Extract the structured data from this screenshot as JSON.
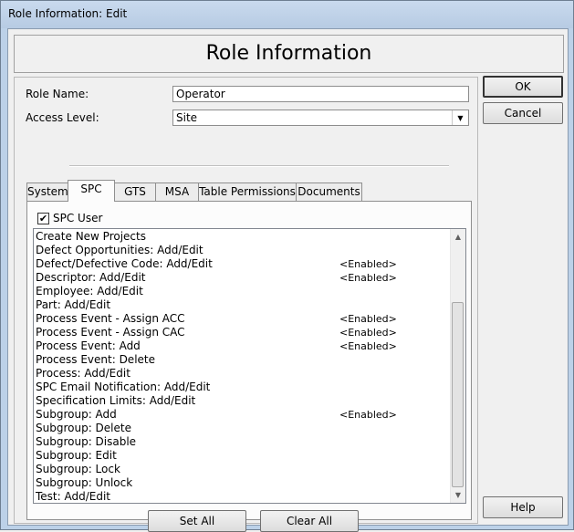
{
  "window": {
    "title": "Role Information: Edit"
  },
  "header": {
    "title": "Role Information"
  },
  "form": {
    "role_name_label": "Role Name:",
    "role_name_value": "Operator",
    "access_level_label": "Access Level:",
    "access_level_value": "Site"
  },
  "tabs": [
    {
      "label": "System"
    },
    {
      "label": "SPC"
    },
    {
      "label": "GTS"
    },
    {
      "label": "MSA"
    },
    {
      "label": "Table Permissions"
    },
    {
      "label": "Documents"
    }
  ],
  "active_tab": "SPC",
  "spc": {
    "user_checkbox_label": "SPC User",
    "user_checked": true,
    "permissions": [
      {
        "name": "Create New Projects",
        "status": ""
      },
      {
        "name": "Defect Opportunities: Add/Edit",
        "status": ""
      },
      {
        "name": "Defect/Defective Code: Add/Edit",
        "status": "<Enabled>"
      },
      {
        "name": "Descriptor: Add/Edit",
        "status": "<Enabled>"
      },
      {
        "name": "Employee: Add/Edit",
        "status": ""
      },
      {
        "name": "Part: Add/Edit",
        "status": ""
      },
      {
        "name": "Process Event - Assign ACC",
        "status": "<Enabled>"
      },
      {
        "name": "Process Event - Assign CAC",
        "status": "<Enabled>"
      },
      {
        "name": "Process Event: Add",
        "status": "<Enabled>"
      },
      {
        "name": "Process Event: Delete",
        "status": ""
      },
      {
        "name": "Process: Add/Edit",
        "status": ""
      },
      {
        "name": "SPC Email Notification: Add/Edit",
        "status": ""
      },
      {
        "name": "Specification Limits: Add/Edit",
        "status": ""
      },
      {
        "name": "Subgroup: Add",
        "status": "<Enabled>"
      },
      {
        "name": "Subgroup: Delete",
        "status": ""
      },
      {
        "name": "Subgroup: Disable",
        "status": ""
      },
      {
        "name": "Subgroup: Edit",
        "status": ""
      },
      {
        "name": "Subgroup: Lock",
        "status": ""
      },
      {
        "name": "Subgroup: Unlock",
        "status": ""
      },
      {
        "name": "Test: Add/Edit",
        "status": ""
      }
    ],
    "set_all_label": "Set All",
    "clear_all_label": "Clear All"
  },
  "buttons": {
    "ok": "OK",
    "cancel": "Cancel",
    "help": "Help"
  },
  "icons": {
    "checkbox": "check-icon",
    "dropdown": "chevron-down-icon",
    "scroll_up": "arrow-up-icon",
    "scroll_down": "arrow-down-icon"
  }
}
